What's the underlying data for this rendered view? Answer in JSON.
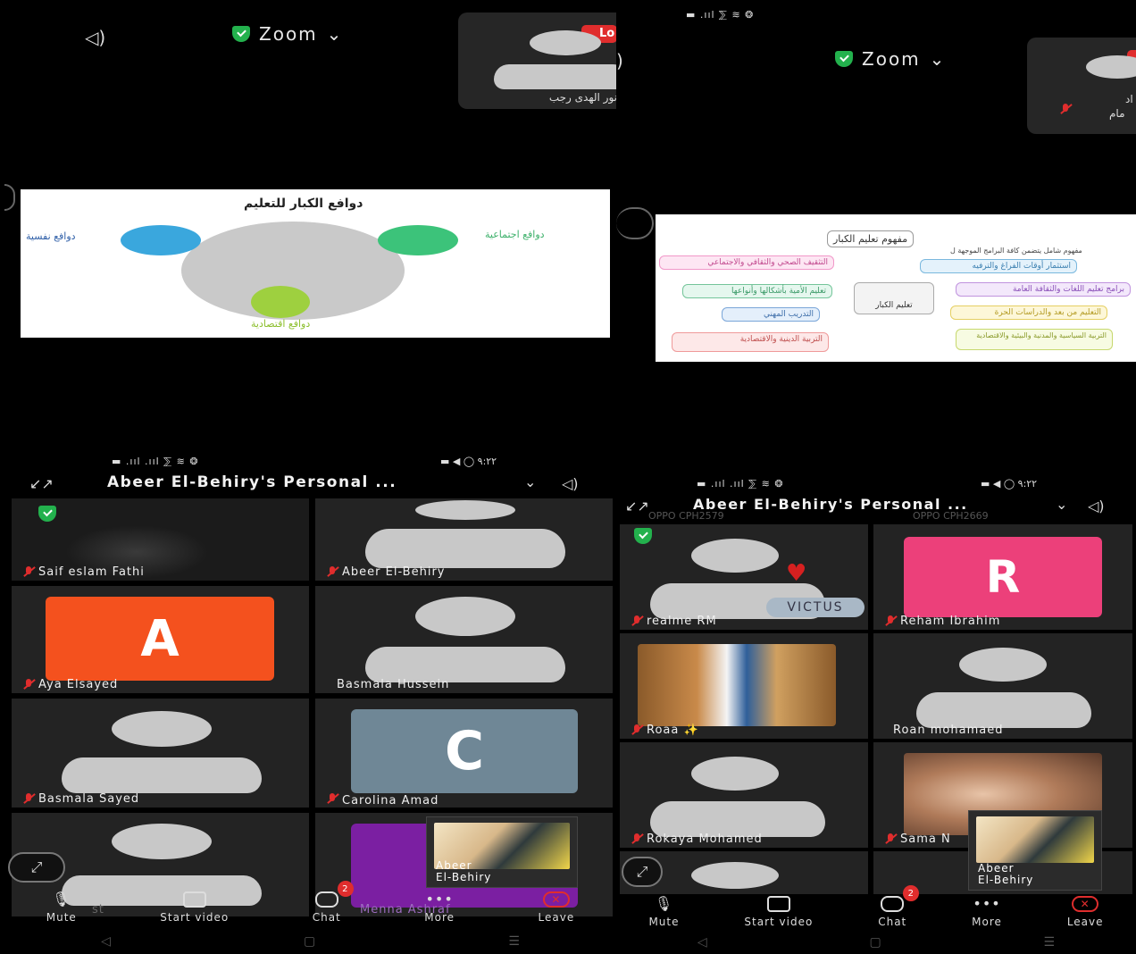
{
  "q1": {
    "speaker_icon": "speaker-icon",
    "title": "Zoom",
    "chevron": "⌄",
    "rec_badge": "Lo",
    "participant_name": "نور الهدى رجب",
    "slide": {
      "title": "دوافع الكبار للتعليم",
      "left": "دوافع نفسية",
      "right": "دوافع اجتماعية",
      "bottom": "دوافع اقتصادية"
    }
  },
  "q2": {
    "status": "▬ .ııl ⅀ ≋ ❂",
    "speaker_icon": "speaker-icon",
    "title": "Zoom",
    "chevron": "⌄",
    "participant_name_1": "اد",
    "participant_name_2": "مام",
    "slide": {
      "title": "مفهوم تعليم الكبار",
      "subtitle": "مفهوم شامل يتضمن كافة البرامج الموجهة ل",
      "center": "تعليم الكبار",
      "nodes_left": [
        "التثقيف الصحي والثقافي والاجتماعي",
        "تعليم الأمية بأشكالها وأنواعها",
        "التدريب المهني",
        "التربية الدينية والاقتصادية"
      ],
      "nodes_right": [
        "استثمار أوقات الفراغ والترفيه",
        "برامج تعليم اللغات والثقافة العامة",
        "التعليم من بعد والدراسات الحرة",
        "التربية السياسية والمدنية والبيئية والاقتصادية"
      ]
    }
  },
  "q3": {
    "status_left": "▬ .ııl .ııl ⅀ ≋ ❂",
    "status_right": "▬ ◀ ◯ ٩:٢٢",
    "meeting_title": "Abeer El-Behiry's Personal ...",
    "chevron": "⌄",
    "tiles": [
      {
        "name": "Saif eslam Fathi"
      },
      {
        "name": "Abeer El-Behiry"
      },
      {
        "name": "Aya Elsayed",
        "letter": "A"
      },
      {
        "name": "Basmala Hussein"
      },
      {
        "name": "Basmala Sayed"
      },
      {
        "name": "Carolina Amad"
      }
    ],
    "bottom_names": [
      "st",
      "Menna Ashraf"
    ],
    "self_view": {
      "line1": "Abeer",
      "line2": "El-Behiry"
    },
    "toolbar": {
      "mute": "Mute",
      "start_video": "Start video",
      "chat": "Chat",
      "chat_badge": "2",
      "more": "More",
      "leave": "Leave"
    }
  },
  "q4": {
    "status_left": "▬ .ııl .ııl ⅀ ≋ ❂",
    "status_right": "▬ ◀ ◯ ٩:٢٢",
    "meeting_title": "Abeer El-Behiry's Personal ...",
    "ghost_left": "OPPO CPH2579",
    "ghost_right": "OPPO CPH2669",
    "chevron": "⌄",
    "tiles": [
      {
        "name": "realme RM",
        "overlay": "VICTUS"
      },
      {
        "name": "Reham Ibrahim",
        "letter": "R"
      },
      {
        "name": "Roaa ✨"
      },
      {
        "name": "Roan mohamaed"
      },
      {
        "name": "Rokaya Mohamed"
      },
      {
        "name": "Sama N"
      }
    ],
    "self_view": {
      "line1": "Abeer",
      "line2": "El-Behiry"
    },
    "toolbar": {
      "mute": "Mute",
      "start_video": "Start video",
      "chat": "Chat",
      "chat_badge": "2",
      "more": "More",
      "leave": "Leave"
    }
  },
  "colors": {
    "zoom_green": "#23b14d",
    "mute_red": "#e02d2d",
    "avatar_orange": "#f4511e",
    "avatar_slate": "#6f8796",
    "avatar_pink": "#ec407a",
    "avatar_purple": "#7b1fa2"
  },
  "nav": {
    "back": "◁",
    "home": "▢",
    "recents": "☰"
  }
}
